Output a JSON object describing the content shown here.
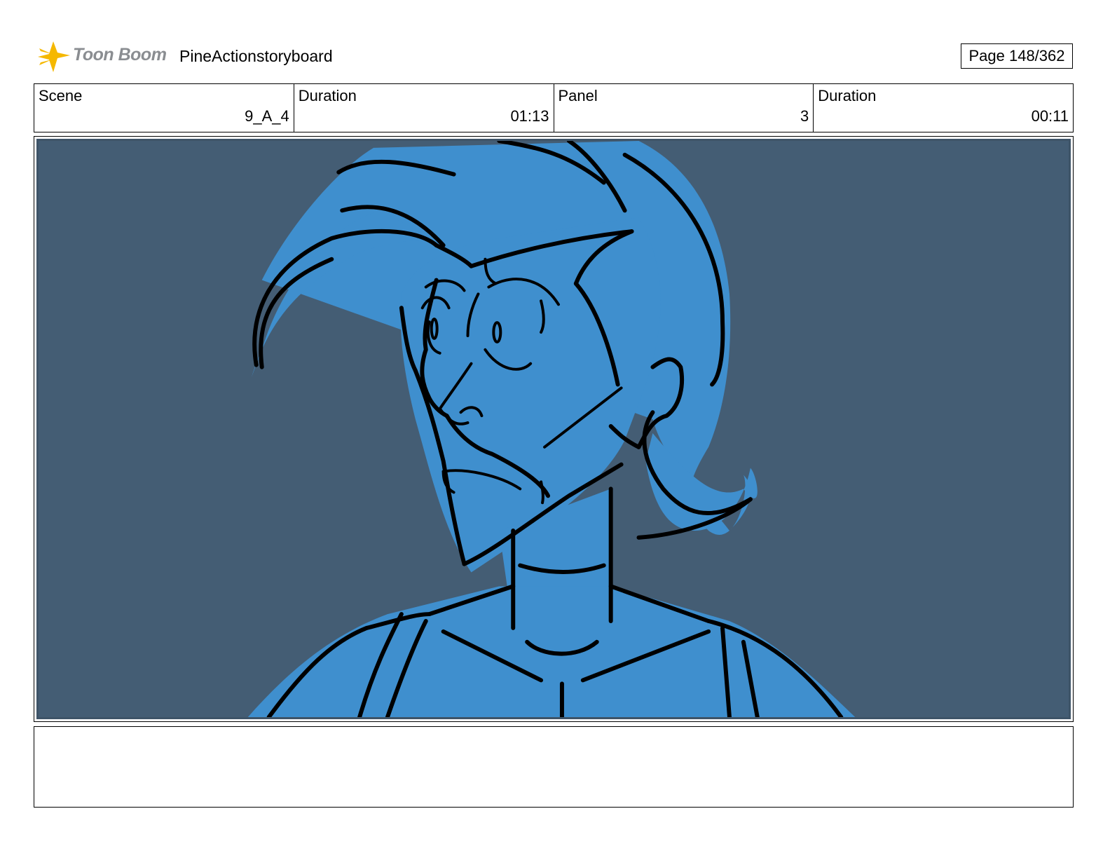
{
  "header": {
    "logo_text": "Toon Boom",
    "project_title": "PineActionstoryboard",
    "page_label": "Page 148/362"
  },
  "info": {
    "scene_label": "Scene",
    "scene_value": "9_A_4",
    "scene_duration_label": "Duration",
    "scene_duration_value": "01:13",
    "panel_label": "Panel",
    "panel_value": "3",
    "panel_duration_label": "Duration",
    "panel_duration_value": "00:11"
  },
  "colors": {
    "background": "#445d74",
    "character_fill": "#3f8fce",
    "line": "#000000",
    "logo_star": "#f5b800"
  }
}
